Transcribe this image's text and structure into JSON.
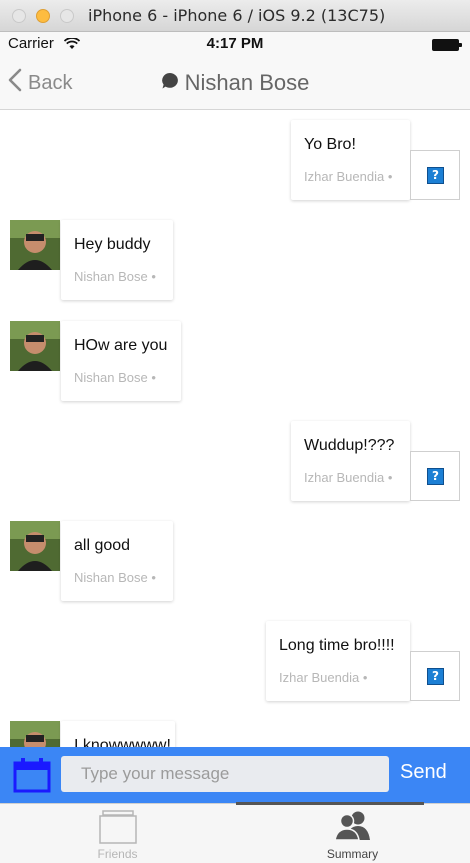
{
  "window": {
    "title": "iPhone 6 - iPhone 6 / iOS 9.2 (13C75)"
  },
  "status_bar": {
    "carrier": "Carrier",
    "time": "4:17 PM"
  },
  "nav": {
    "back_label": "Back",
    "title": "Nishan Bose"
  },
  "messages": [
    {
      "text": "Yo Bro!",
      "meta": "Izhar Buendia •",
      "side": "right"
    },
    {
      "text": "Hey buddy",
      "meta": "Nishan Bose •",
      "side": "left"
    },
    {
      "text": "HOw are you",
      "meta": "Nishan Bose •",
      "side": "left"
    },
    {
      "text": "Wuddup!???",
      "meta": "Izhar Buendia •",
      "side": "right"
    },
    {
      "text": "all good",
      "meta": "Nishan Bose •",
      "side": "left"
    },
    {
      "text": "Long time bro!!!!",
      "meta": "Izhar Buendia •",
      "side": "right"
    },
    {
      "text": "I knowwwww!",
      "meta": "",
      "side": "left"
    }
  ],
  "input_bar": {
    "placeholder": "Type your message",
    "send_label": "Send"
  },
  "tabs": [
    {
      "label": "Friends",
      "icon": "friends-tab-icon",
      "active": false
    },
    {
      "label": "Summary",
      "icon": "summary-tab-icon",
      "active": true
    }
  ],
  "colors": {
    "accent": "#3b86f5",
    "calendar_icon": "#1a1aff",
    "question_icon": "#1c7fd4"
  }
}
